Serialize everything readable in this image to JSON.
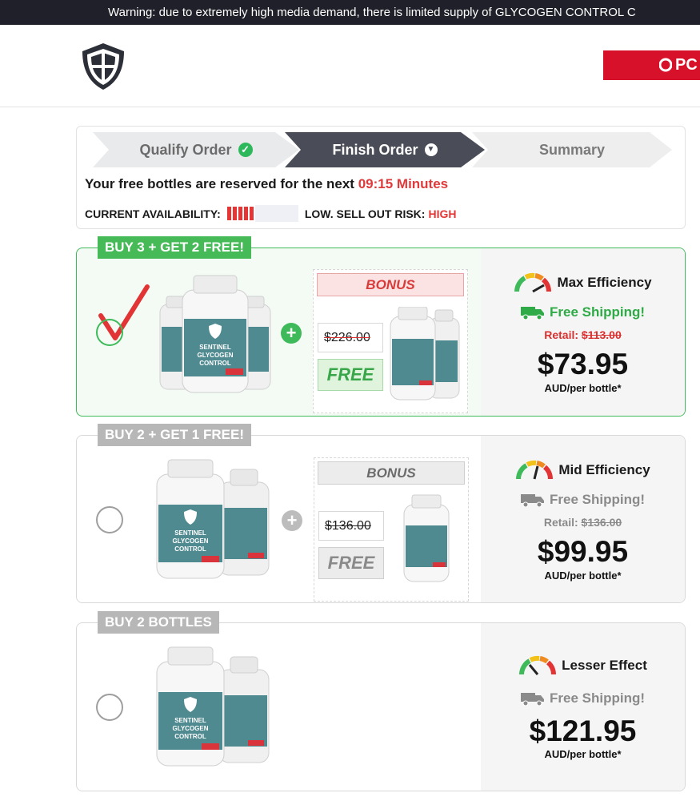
{
  "warning_bar": {
    "text": "Warning: due to extremely high media demand, there is limited supply of GLYCOGEN CONTROL C"
  },
  "header": {
    "partner_text": "PC"
  },
  "progress": {
    "steps": [
      {
        "label": "Qualify Order",
        "state": "done"
      },
      {
        "label": "Finish Order",
        "state": "current"
      },
      {
        "label": "Summary",
        "state": "upcoming"
      }
    ],
    "reserve_prefix": "Your free bottles are reserved for the next",
    "timer": "09:15 Minutes",
    "availability_label": "CURRENT AVAILABILITY:",
    "availability_level": 0.45,
    "risk_label": "LOW. SELL OUT RISK:",
    "risk_value": "HIGH"
  },
  "offers": [
    {
      "tag": "BUY 3 + GET 2 FREE!",
      "selected": true,
      "bonus_label": "BONUS",
      "old_price": "$226.00",
      "free_label": "FREE",
      "efficiency": "Max Efficiency",
      "shipping": "Free Shipping!",
      "retail_label": "Retail:",
      "retail_price": "$113.00",
      "price": "$73.95",
      "per_bottle": "AUD/per bottle*"
    },
    {
      "tag": "BUY 2 + GET 1 FREE!",
      "selected": false,
      "bonus_label": "BONUS",
      "old_price": "$136.00",
      "free_label": "FREE",
      "efficiency": "Mid Efficiency",
      "shipping": "Free Shipping!",
      "retail_label": "Retail:",
      "retail_price": "$136.00",
      "price": "$99.95",
      "per_bottle": "AUD/per bottle*"
    },
    {
      "tag": "BUY 2 BOTTLES",
      "selected": false,
      "efficiency": "Lesser Effect",
      "shipping": "Free Shipping!",
      "price": "$121.95",
      "per_bottle": "AUD/per bottle*"
    }
  ],
  "product_label": {
    "line1": "SENTINEL",
    "line2": "GLYCOGEN",
    "line3": "CONTROL"
  },
  "colors": {
    "accent_green": "#3fba5a",
    "alert_red": "#e53535",
    "bottle_teal": "#4f8a91",
    "header_dark": "#1f2029"
  },
  "icons": [
    "shield-logo-icon",
    "check-circle-icon",
    "chevron-down-icon",
    "checkmark-icon",
    "plus-circle-icon",
    "gauge-icon",
    "truck-icon"
  ]
}
